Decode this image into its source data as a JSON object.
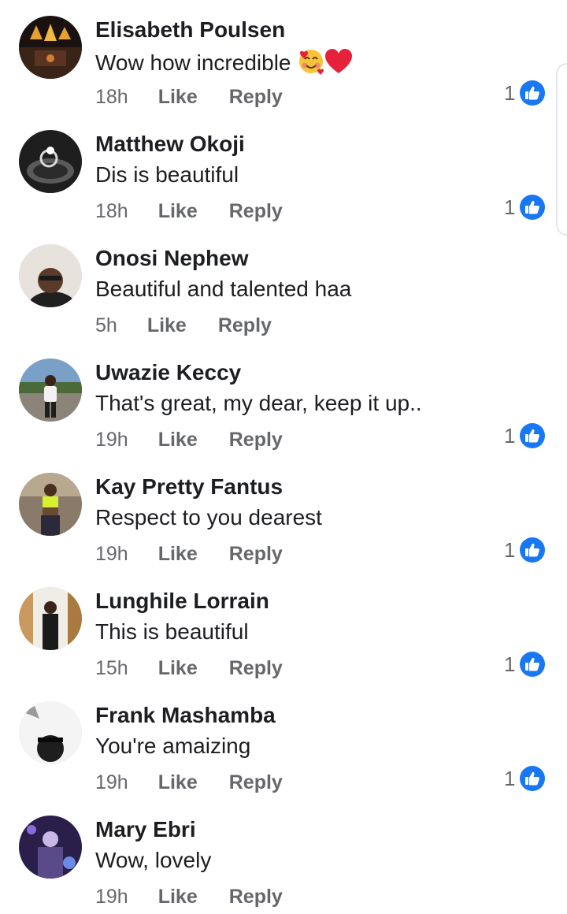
{
  "comments": [
    {
      "author": "Elisabeth Poulsen",
      "text": "Wow how incredible",
      "emoji": [
        "smiling-face-with-hearts",
        "red-heart"
      ],
      "time": "18h",
      "like_label": "Like",
      "reply_label": "Reply",
      "likes": "1"
    },
    {
      "author": "Matthew Okoji",
      "text": "Dis is beautiful",
      "time": "18h",
      "like_label": "Like",
      "reply_label": "Reply",
      "likes": "1"
    },
    {
      "author": "Onosi Nephew",
      "text": "Beautiful and talented haa",
      "time": "5h",
      "like_label": "Like",
      "reply_label": "Reply"
    },
    {
      "author": "Uwazie Keccy",
      "text": "That's great, my dear, keep it up..",
      "time": "19h",
      "like_label": "Like",
      "reply_label": "Reply",
      "likes": "1"
    },
    {
      "author": "Kay Pretty Fantus",
      "text": "Respect to you dearest",
      "time": "19h",
      "like_label": "Like",
      "reply_label": "Reply",
      "likes": "1"
    },
    {
      "author": "Lunghile Lorrain",
      "text": "This is beautiful",
      "time": "15h",
      "like_label": "Like",
      "reply_label": "Reply",
      "likes": "1"
    },
    {
      "author": "Frank Mashamba",
      "text": "You're amaizing",
      "time": "19h",
      "like_label": "Like",
      "reply_label": "Reply",
      "likes": "1"
    },
    {
      "author": "Mary Ebri",
      "text": "Wow, lovely",
      "time": "19h",
      "like_label": "Like",
      "reply_label": "Reply"
    }
  ],
  "colors": {
    "author": "#1c1e21",
    "meta": "#65676b",
    "like_badge": "#1877f2"
  },
  "icons": {
    "like_reaction": "thumbs-up-icon"
  }
}
